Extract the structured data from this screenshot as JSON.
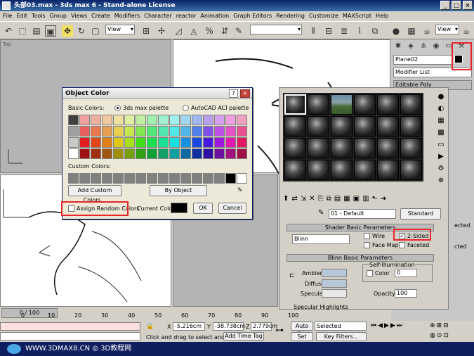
{
  "window": {
    "title": "头部03.max - 3ds max 6 - Stand-alone License",
    "min": "_",
    "max": "□",
    "close": "×"
  },
  "menu": [
    "File",
    "Edit",
    "Tools",
    "Group",
    "Views",
    "Create",
    "Modifiers",
    "Character",
    "reactor",
    "Animation",
    "Graph Editors",
    "Rendering",
    "Customize",
    "MAXScript",
    "Help"
  ],
  "toolbar": {
    "ref_coord": "View"
  },
  "viewports": {
    "top_label": "Top"
  },
  "command_panel": {
    "object_name": "Plane02",
    "modifier_list": "Modifier List",
    "stack_item": "Editable Poly",
    "side_labels": [
      "ected",
      "cted"
    ]
  },
  "object_color": {
    "title": "Object Color",
    "help": "?",
    "close": "×",
    "basic_colors_label": "Basic Colors:",
    "palette_max": "3ds max palette",
    "palette_aci": "AutoCAD ACI palette",
    "custom_colors_label": "Custom Colors:",
    "add_custom": "Add Custom Colors...",
    "by_object": "By Object",
    "assign_random": "Assign Random Colors",
    "current_color_label": "Current Color:",
    "ok": "OK",
    "cancel": "Cancel",
    "current_color": "#000000",
    "swatch_colors": [
      "#404040",
      "#f0a0a0",
      "#f0b0a0",
      "#f0c8a0",
      "#f0e0a0",
      "#e0f0a0",
      "#c0f0a0",
      "#a0f0b0",
      "#a0f0d0",
      "#a0f0f0",
      "#a0d8f0",
      "#a0b8f0",
      "#b8a0f0",
      "#d8a0f0",
      "#f0a0e0",
      "#f0a0c0",
      "#a0a0a0",
      "#e86060",
      "#e87850",
      "#e8a050",
      "#e8d050",
      "#c8e850",
      "#80e850",
      "#50e878",
      "#50e8b0",
      "#50e8e8",
      "#50b8e8",
      "#5080e8",
      "#8050e8",
      "#c050e8",
      "#e850c8",
      "#e85090",
      "#c8c8c8",
      "#e02020",
      "#e04818",
      "#e08018",
      "#e0c818",
      "#a8e018",
      "#40e018",
      "#18e050",
      "#18e090",
      "#18e0e0",
      "#1890e0",
      "#1848e0",
      "#4818e0",
      "#a018e0",
      "#e018b0",
      "#e01860",
      "#ffffff",
      "#a01010",
      "#a03010",
      "#a05810",
      "#a09010",
      "#78a010",
      "#30a010",
      "#10a038",
      "#10a068",
      "#10a0a0",
      "#1068a0",
      "#1030a0",
      "#3010a0",
      "#7010a0",
      "#a01080",
      "#a01048"
    ],
    "custom_swatches": [
      "#808080",
      "#808080",
      "#808080",
      "#808080",
      "#808080",
      "#808080",
      "#808080",
      "#808080",
      "#808080",
      "#808080",
      "#808080",
      "#808080",
      "#808080",
      "#808080",
      "#000000",
      "#ffffff"
    ]
  },
  "material_editor": {
    "material_name": "01 - Default",
    "type_button": "Standard",
    "rollout_shader": "Shader Basic Parameters",
    "shader": "Blinn",
    "wire": "Wire",
    "two_sided": "2-Sided",
    "face_map": "Face Map",
    "faceted": "Faceted",
    "rollout_blinn": "Blinn Basic Parameters",
    "self_illum_label": "Self-Illumination",
    "ambient": "Ambient:",
    "diffuse": "Diffuse:",
    "specular": "Specular:",
    "color_label": "Color",
    "color_value": "0",
    "opacity_label": "Opacity:",
    "opacity_value": "100",
    "spec_highlights": "Specular Highlights"
  },
  "timeline": {
    "frame": "0 / 100",
    "ticks": [
      "0",
      "10",
      "20",
      "30",
      "40",
      "50",
      "60",
      "70",
      "80",
      "90",
      "100"
    ]
  },
  "status": {
    "x_label": "X",
    "x_value": "-5.216cm",
    "y_label": "Y",
    "y_value": "-38.738cm",
    "z_label": "Z",
    "z_value": "2.779cm",
    "prompt": "Click and drag to select and move",
    "add_time_tag": "Add Time Tag",
    "auto_key": "Auto Key",
    "set_key": "Set Key",
    "selected": "Selected",
    "key_filters": "Key Filters..."
  },
  "footer": {
    "text": "WWW.3DMAX8.CN ◎ 3D教程网"
  }
}
